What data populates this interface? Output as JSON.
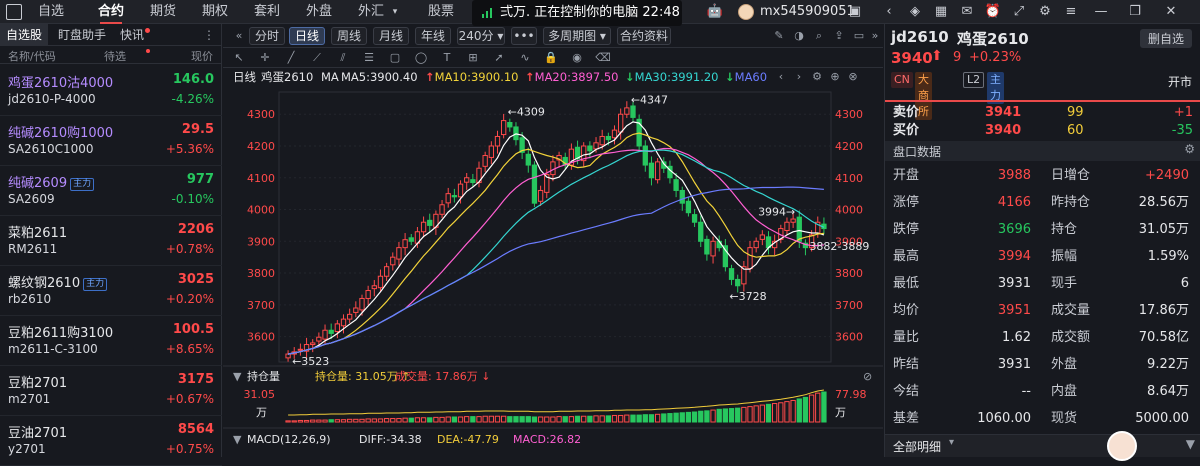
{
  "nav": {
    "tabs": [
      "自选",
      "合约",
      "期货",
      "期权",
      "套利",
      "外盘",
      "外汇",
      "股票"
    ],
    "active_index": 1,
    "banner": "弍万. 正在控制你的电脑 22:48",
    "account": "mx545909051"
  },
  "left": {
    "tabs": [
      "自选股",
      "盯盘助手",
      "快讯"
    ],
    "header_name": "名称/代码",
    "header_sort": "待选",
    "header_price": "现价",
    "badge_text": "主力",
    "rows": [
      {
        "name": "鸡蛋2610沽4000",
        "code": "jd2610-P-4000",
        "price": "146.0",
        "change": "-4.26%",
        "color": "purple",
        "dir": "down",
        "badge": false
      },
      {
        "name": "纯碱2610购1000",
        "code": "SA2610C1000",
        "price": "29.5",
        "change": "+5.36%",
        "color": "purple",
        "dir": "up",
        "badge": false
      },
      {
        "name": "纯碱2609",
        "code": "SA2609",
        "price": "977",
        "change": "-0.10%",
        "color": "purple",
        "dir": "down",
        "badge": true
      },
      {
        "name": "菜粕2611",
        "code": "RM2611",
        "price": "2206",
        "change": "+0.78%",
        "color": "white",
        "dir": "up",
        "badge": false
      },
      {
        "name": "螺纹钢2610",
        "code": "rb2610",
        "price": "3025",
        "change": "+0.20%",
        "color": "white",
        "dir": "up",
        "badge": true
      },
      {
        "name": "豆粕2611购3100",
        "code": "m2611-C-3100",
        "price": "100.5",
        "change": "+8.65%",
        "color": "white",
        "dir": "up",
        "badge": false
      },
      {
        "name": "豆粕2701",
        "code": "m2701",
        "price": "3175",
        "change": "+0.67%",
        "color": "white",
        "dir": "up",
        "badge": false
      },
      {
        "name": "豆油2701",
        "code": "y2701",
        "price": "8564",
        "change": "+0.75%",
        "color": "white",
        "dir": "up",
        "badge": false
      }
    ]
  },
  "toolbar": {
    "periods": [
      "分时",
      "日线",
      "周线",
      "月线",
      "年线",
      "240分"
    ],
    "active_period": 1,
    "more": "•••",
    "multi": "多周期图",
    "contract_info": "合约资料"
  },
  "ma": {
    "period": "日线",
    "name": "鸡蛋2610",
    "label": "MA",
    "ma5": "MA5:3900.40",
    "ma10": "MA10:3900.10",
    "ma20": "MA20:3897.50",
    "ma30": "MA30:3991.20",
    "ma60": "MA60",
    "colors": {
      "ma5": "#ffffff",
      "ma10": "#f2d33a",
      "ma20": "#ff5fd2",
      "ma30": "#35d6d1",
      "ma60": "#6b7cff"
    }
  },
  "chart_data": {
    "type": "candlestick",
    "y_ticks": [
      3600,
      3700,
      3800,
      3900,
      4000,
      4100,
      4200,
      4300
    ],
    "ylim": [
      3520,
      4370
    ],
    "annotations": [
      {
        "text": "←4309",
        "value": 4309
      },
      {
        "text": "←4347",
        "value": 4347
      },
      {
        "text": "3994→",
        "value": 3994
      },
      {
        "text": "3882-3889",
        "value": 3885
      },
      {
        "text": "←3728",
        "value": 3728
      },
      {
        "text": "←3523",
        "value": 3523
      }
    ],
    "candles": [
      3545,
      3552,
      3560,
      3575,
      3580,
      3598,
      3620,
      3610,
      3640,
      3655,
      3670,
      3690,
      3720,
      3745,
      3760,
      3790,
      3820,
      3850,
      3880,
      3905,
      3900,
      3930,
      3960,
      3950,
      3985,
      4015,
      4050,
      4040,
      4080,
      4100,
      4085,
      4130,
      4170,
      4200,
      4230,
      4280,
      4260,
      4220,
      4180,
      4140,
      4020,
      4060,
      4110,
      4150,
      4170,
      4140,
      4190,
      4160,
      4200,
      4185,
      4210,
      4230,
      4220,
      4250,
      4300,
      4320,
      4290,
      4200,
      4140,
      4100,
      4150,
      4130,
      4100,
      4060,
      4020,
      3990,
      3960,
      3900,
      3860,
      3900,
      3880,
      3820,
      3780,
      3760,
      3820,
      3880,
      3900,
      3920,
      3880,
      3900,
      3940,
      3960,
      3970,
      3900,
      3880,
      3920,
      3960,
      3940
    ],
    "volume_panel": {
      "label": "持仓量",
      "oi": "持仓量: 31.05万",
      "vol": "成交量: 17.86万",
      "left_top": "31.05",
      "left_unit": "万",
      "right_top": "77.98",
      "right_unit": "万"
    },
    "volume": [
      3,
      3,
      4,
      4,
      5,
      5,
      5,
      6,
      6,
      6,
      7,
      7,
      7,
      8,
      8,
      8,
      9,
      9,
      9,
      10,
      10,
      11,
      11,
      11,
      12,
      12,
      13,
      13,
      13,
      14,
      14,
      14,
      15,
      15,
      15,
      15,
      14,
      14,
      14,
      14,
      13,
      13,
      13,
      13,
      14,
      14,
      14,
      15,
      15,
      15,
      16,
      16,
      16,
      17,
      17,
      18,
      18,
      18,
      19,
      19,
      20,
      21,
      22,
      23,
      24,
      25,
      26,
      28,
      29,
      31,
      33,
      34,
      35,
      36,
      38,
      40,
      42,
      44,
      46,
      48,
      50,
      53,
      56,
      60,
      64,
      70,
      75,
      78
    ],
    "macd": {
      "label": "MACD(12,26,9)",
      "diff": "DIFF:-34.38",
      "dea": "DEA:-47.79",
      "macd": "MACD:26.82"
    }
  },
  "right": {
    "code": "jd2610",
    "name": "鸡蛋2610",
    "remove_btn": "删自选",
    "price": "3940",
    "change": "9",
    "change_pct": "+0.23%",
    "tags": [
      "CN",
      "大商所",
      "L2",
      "主力"
    ],
    "status": "开市",
    "ask": {
      "label": "卖价",
      "price": "3941",
      "vol": "99",
      "chg": "+1"
    },
    "bid": {
      "label": "买价",
      "price": "3940",
      "vol": "60",
      "chg": "-35"
    },
    "section": "盘口数据",
    "stats": [
      {
        "l1": "开盘",
        "v1": "3988",
        "c1": "red",
        "l2": "日增仓",
        "v2": "+2490",
        "c2": "red"
      },
      {
        "l1": "涨停",
        "v1": "4166",
        "c1": "red",
        "l2": "昨持仓",
        "v2": "28.56万",
        "c2": "white"
      },
      {
        "l1": "跌停",
        "v1": "3696",
        "c1": "green",
        "l2": "持仓",
        "v2": "31.05万",
        "c2": "white"
      },
      {
        "l1": "最高",
        "v1": "3994",
        "c1": "red",
        "l2": "振幅",
        "v2": "1.59%",
        "c2": "white"
      },
      {
        "l1": "最低",
        "v1": "3931",
        "c1": "white",
        "l2": "现手",
        "v2": "6",
        "c2": "white"
      },
      {
        "l1": "均价",
        "v1": "3951",
        "c1": "red",
        "l2": "成交量",
        "v2": "17.86万",
        "c2": "white"
      },
      {
        "l1": "量比",
        "v1": "1.62",
        "c1": "white",
        "l2": "成交额",
        "v2": "70.58亿",
        "c2": "white"
      },
      {
        "l1": "昨结",
        "v1": "3931",
        "c1": "white",
        "l2": "外盘",
        "v2": "9.22万",
        "c2": "white"
      },
      {
        "l1": "今结",
        "v1": "--",
        "c1": "white",
        "l2": "内盘",
        "v2": "8.64万",
        "c2": "white"
      },
      {
        "l1": "基差",
        "v1": "1060.00",
        "c1": "white",
        "l2": "现货",
        "v2": "5000.00",
        "c2": "white"
      }
    ],
    "detail_tab": "全部明细"
  }
}
